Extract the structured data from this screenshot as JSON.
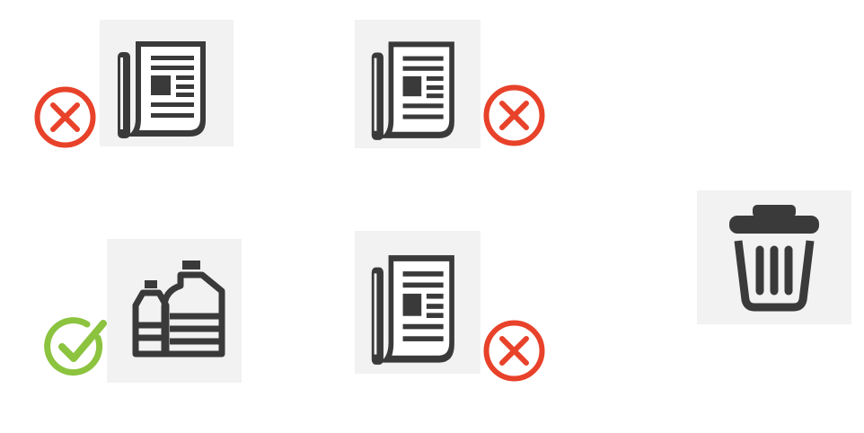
{
  "items": [
    {
      "icon": "newspaper-icon",
      "status": "incorrect",
      "status_icon": "red-x-circle-icon"
    },
    {
      "icon": "newspaper-icon",
      "status": "incorrect",
      "status_icon": "red-x-circle-icon"
    },
    {
      "icon": "bottles-icon",
      "status": "correct",
      "status_icon": "green-checkmark-circle-icon"
    },
    {
      "icon": "newspaper-icon",
      "status": "incorrect",
      "status_icon": "red-x-circle-icon"
    },
    {
      "icon": "trash-can-icon",
      "status": "none",
      "status_icon": ""
    }
  ],
  "colors": {
    "tile_bg": "#f1f2f1",
    "icon_dark": "#3a3a3a",
    "cross_red": "#e8422a",
    "check_green": "#8cc33f"
  }
}
